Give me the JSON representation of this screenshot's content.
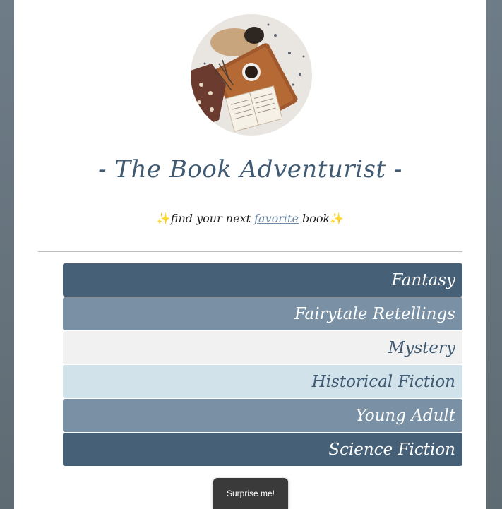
{
  "header": {
    "title": "- The Book Adventurist -",
    "tagline_prefix": "find your next",
    "tagline_link": "favorite",
    "tagline_suffix": "book",
    "sparkle_icon": "sparkles-icon"
  },
  "genres": [
    {
      "label": "Fantasy",
      "bg": "#466077",
      "fg": "#ffffff"
    },
    {
      "label": "Fairytale Retellings",
      "bg": "#7a91a5",
      "fg": "#ffffff"
    },
    {
      "label": "Mystery",
      "bg": "#f1f1f1",
      "fg": "#3f5a72"
    },
    {
      "label": "Historical Fiction",
      "bg": "#d1e2ea",
      "fg": "#3f5a72"
    },
    {
      "label": "Young Adult",
      "bg": "#7a91a5",
      "fg": "#ffffff"
    },
    {
      "label": "Science Fiction",
      "bg": "#466077",
      "fg": "#ffffff"
    }
  ],
  "surprise_button": {
    "label": "Surprise me!"
  },
  "colors": {
    "accent": "#466077",
    "page_bg": "#ffffff",
    "frame": "#6e7c88"
  }
}
